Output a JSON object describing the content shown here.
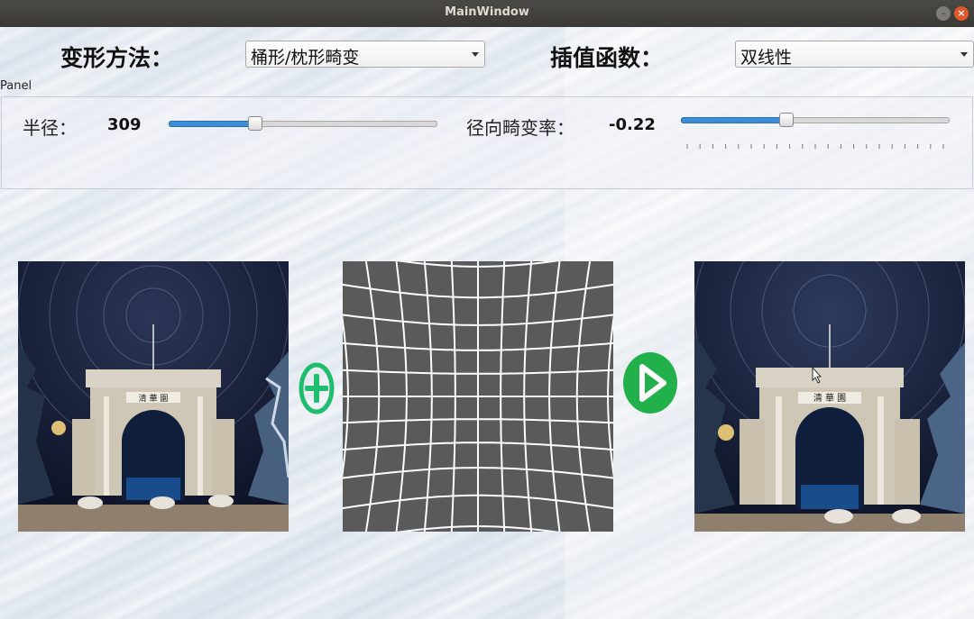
{
  "window": {
    "title": "MainWindow",
    "minimize_icon": "minimize-icon",
    "close_icon": "close-icon"
  },
  "controls": {
    "method_label": "变形方法：",
    "method_value": "桶形/枕形畸变",
    "interp_label": "插值函数：",
    "interp_value": "双线性"
  },
  "panel": {
    "title": "Panel",
    "radius_label": "半径：",
    "radius_value": "309",
    "radius_slider_fraction": 0.32,
    "distortion_label": "径向畸变率：",
    "distortion_value": "-0.22",
    "distortion_slider_fraction": 0.39
  },
  "images": {
    "source": "source-image-tsinghua-gate",
    "grid": "distortion-grid-image",
    "result": "result-image-tsinghua-gate",
    "plus_icon": "plus-circle-icon",
    "play_icon": "play-icon",
    "gate_sign": "清 華 園"
  },
  "colors": {
    "accent": "#3d8ed6",
    "plus": "#1fbd6e",
    "play": "#22b04b",
    "grid_bg": "#5a5a5a"
  }
}
